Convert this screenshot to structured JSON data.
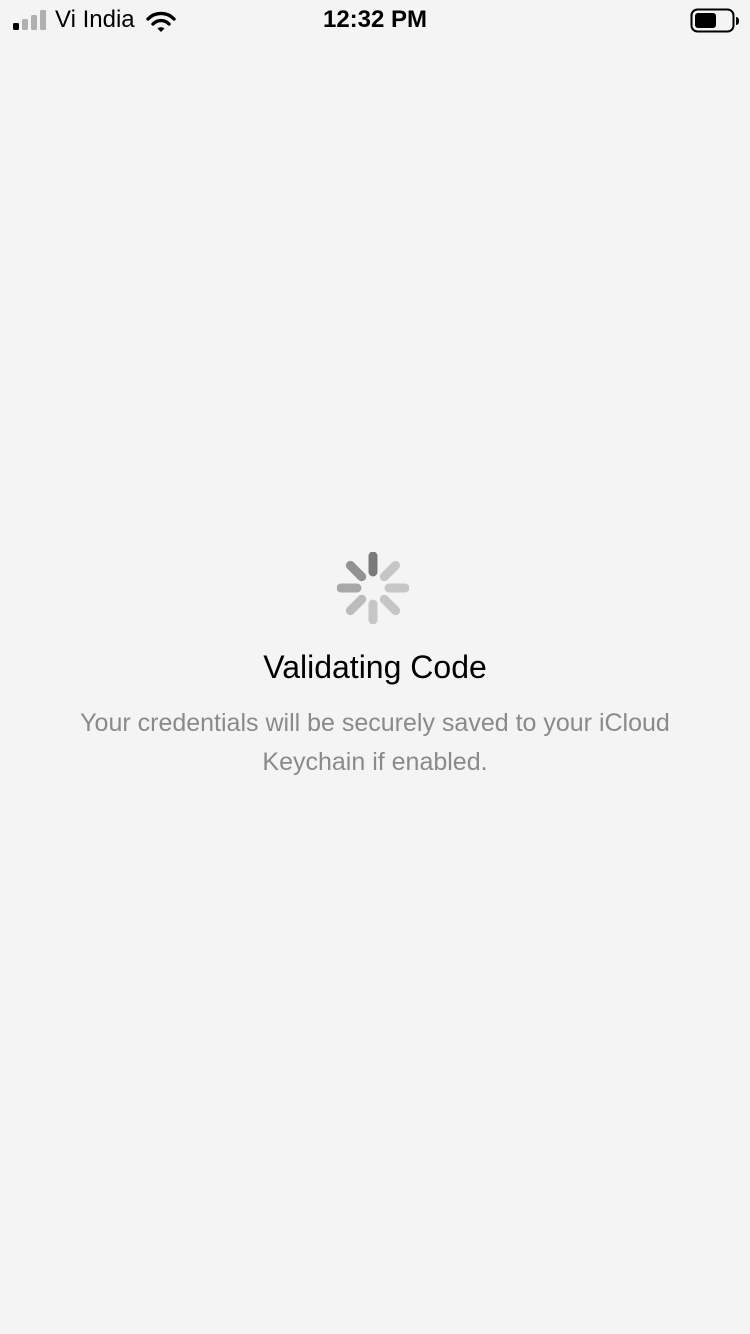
{
  "status_bar": {
    "carrier": "Vi India",
    "time": "12:32 PM",
    "signal_bars_active": 1,
    "signal_bars_total": 4,
    "battery_level_fraction": 0.6,
    "signal_icon": "cellular-signal-icon",
    "wifi_icon": "wifi-icon",
    "battery_icon": "battery-icon"
  },
  "main": {
    "spinner_icon": "activity-spinner-icon",
    "title": "Validating Code",
    "subtitle": "Your credentials will be securely saved to your iCloud Keychain if enabled."
  },
  "colors": {
    "background": "#f4f4f4",
    "title_text": "#000000",
    "subtitle_text": "#8a8a8a",
    "spinner_dark": "#7a7a7a",
    "spinner_light": "#c2c2c2"
  }
}
